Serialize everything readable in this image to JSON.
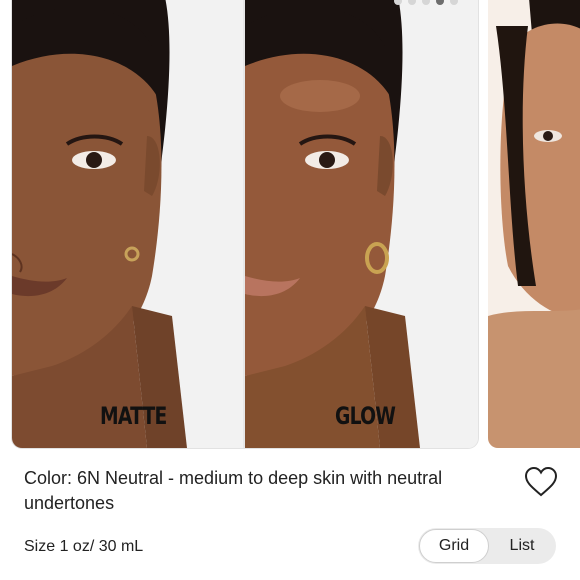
{
  "carousel": {
    "left_label": "MATTE",
    "right_label": "GLOW",
    "dot_count": 5,
    "active_dot": 3
  },
  "product": {
    "color_description": "Color: 6N Neutral - medium to deep skin with neutral undertones",
    "size": "Size 1 oz/ 30 mL"
  },
  "view_toggle": {
    "grid_label": "Grid",
    "list_label": "List",
    "selected": "Grid"
  },
  "colors": {
    "skin": "#8a5537",
    "background": "#f2f2f2",
    "toggle_bg": "#ebebeb"
  }
}
